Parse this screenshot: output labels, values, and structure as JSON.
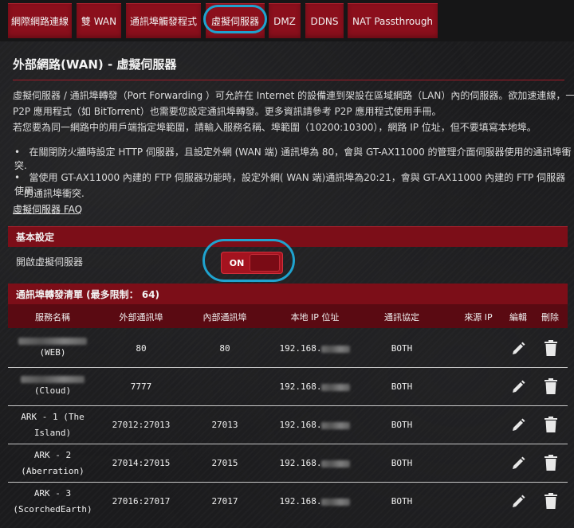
{
  "tabs": [
    {
      "label": "網際網路連線"
    },
    {
      "label": "雙 WAN"
    },
    {
      "label": "通訊埠觸發程式"
    },
    {
      "label": "虛擬伺服器"
    },
    {
      "label": "DMZ"
    },
    {
      "label": "DDNS"
    },
    {
      "label": "NAT Passthrough"
    }
  ],
  "page": {
    "title": "外部網路(WAN) - 虛擬伺服器",
    "desc_line1": "虛擬伺服器 / 通訊埠轉發（Port Forwarding ）可允許在 Internet 的設備連到架設在區域網路（LAN）內的伺服器。欲加速連線，一些",
    "desc_line2": "P2P 應用程式（如 BitTorrent）也需要您設定通訊埠轉發。更多資訊請參考 P2P 應用程式使用手冊。",
    "desc_line3": "若您要為同一網路中的用戶端指定埠範圍，請輸入服務名稱、埠範圍（10200:10300），網路 IP 位址，但不要填寫本地埠。",
    "bullet1": "在關閉防火牆時設定 HTTP 伺服器，且設定外網 (WAN 端) 通訊埠為 80，會與 GT-AX11000 的管理介面伺服器使用的通訊埠衝突.",
    "bullet2_line1": "當使用 GT-AX11000 內建的 FTP 伺服器功能時，設定外網( WAN 端)通訊埠為20:21，會與 GT-AX11000 內建的 FTP 伺服器使用",
    "bullet2_line2": "的通訊埠衝突.",
    "faq": "虛擬伺服器 FAQ"
  },
  "basic": {
    "section_title": "基本設定",
    "enable_label": "開啟虛擬伺服器",
    "toggle_state": "ON"
  },
  "table": {
    "title": "通訊埠轉發清單 (最多限制： 64)",
    "headers": [
      "服務名稱",
      "外部通訊埠",
      "內部通訊埠",
      "本地 IP 位址",
      "通訊協定",
      "來源 IP",
      "編輯",
      "刪除"
    ],
    "rows": [
      {
        "name_line1": "",
        "name_line2": "(WEB)",
        "ext": "80",
        "int": "80",
        "ip": "192.168.",
        "proto": "BOTH",
        "src": ""
      },
      {
        "name_line1": "",
        "name_line2": "(Cloud)",
        "ext": "7777",
        "int": "",
        "ip": "192.168.",
        "proto": "BOTH",
        "src": ""
      },
      {
        "name_line1": "ARK - 1 (The",
        "name_line2": "Island)",
        "ext": "27012:27013",
        "int": "27013",
        "ip": "192.168.",
        "proto": "BOTH",
        "src": ""
      },
      {
        "name_line1": "ARK - 2",
        "name_line2": "(Aberration)",
        "ext": "27014:27015",
        "int": "27015",
        "ip": "192.168.",
        "proto": "BOTH",
        "src": ""
      },
      {
        "name_line1": "ARK - 3",
        "name_line2": "(ScorchedEarth)",
        "ext": "27016:27017",
        "int": "27017",
        "ip": "192.168.",
        "proto": "BOTH",
        "src": ""
      }
    ]
  },
  "colors": {
    "accent": "#8b0f1c",
    "highlight": "#1fa3cf"
  }
}
